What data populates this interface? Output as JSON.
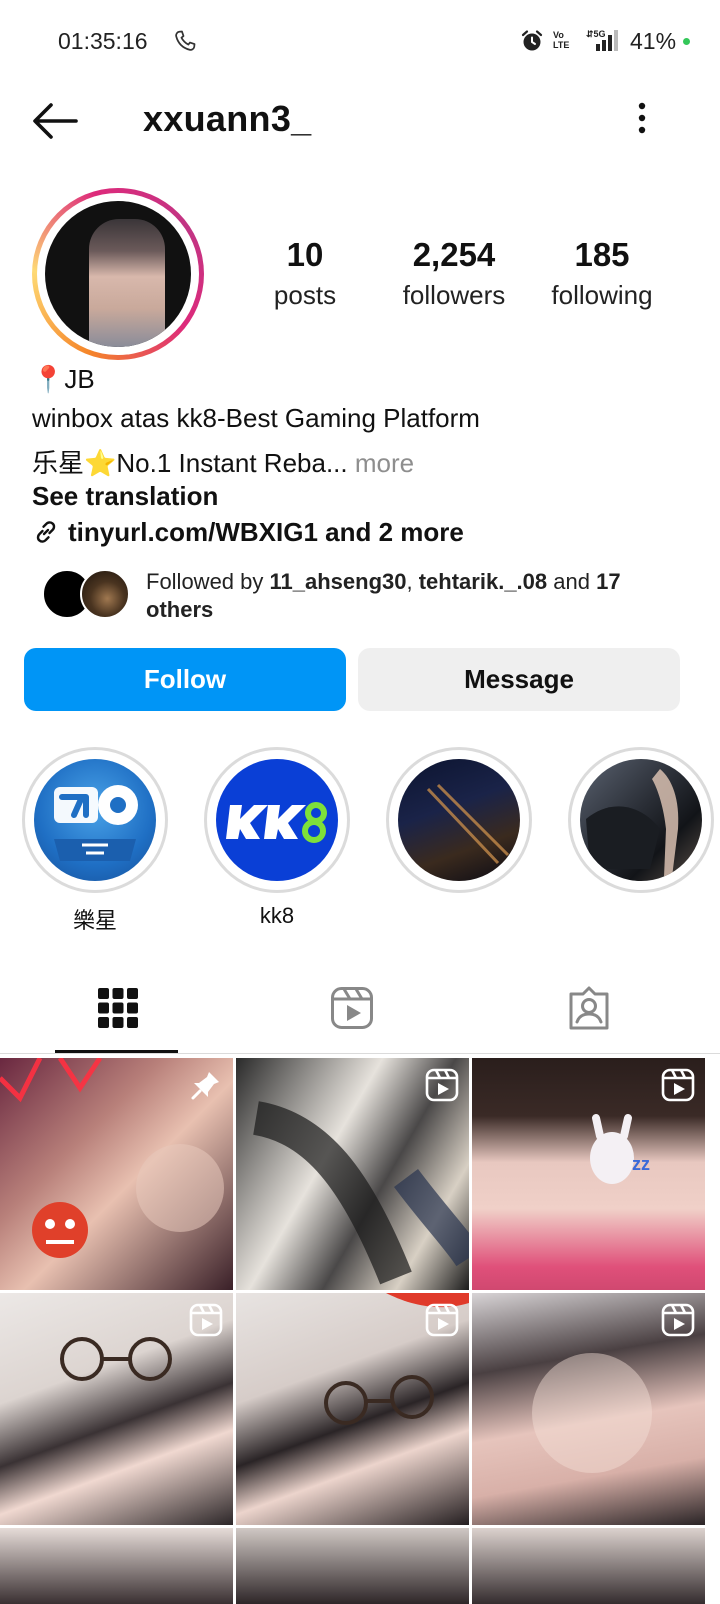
{
  "status_bar": {
    "time": "01:35:16",
    "battery": "41%",
    "network": "5G",
    "volte": "Vo LTE"
  },
  "header": {
    "username": "xxuann3_"
  },
  "profile": {
    "stats": [
      {
        "count": "10",
        "label": "posts"
      },
      {
        "count": "2,254",
        "label": "followers"
      },
      {
        "count": "185",
        "label": "following"
      }
    ],
    "bio": {
      "location": "📍JB",
      "line1": "winbox atas kk8-Best Gaming Platform",
      "line2": "乐星⭐No.1 Instant Reba...",
      "more_label": "more",
      "see_translation": "See translation",
      "link": "tinyurl.com/WBXIG1 and 2 more"
    },
    "followed_by": {
      "prefix": "Followed by ",
      "user1": "11_ahseng30",
      "sep": ", ",
      "user2": "tehtarik._.08",
      "suffix_and": " and ",
      "others_count": "17",
      "others_label": "others"
    }
  },
  "actions": {
    "follow_label": "Follow",
    "message_label": "Message"
  },
  "highlights": [
    {
      "label": "樂星"
    },
    {
      "label": "kk8"
    },
    {
      "label": ""
    },
    {
      "label": ""
    }
  ],
  "tabs": [
    {
      "name": "posts-grid",
      "icon": "grid-icon",
      "active": true
    },
    {
      "name": "reels",
      "icon": "reels-icon",
      "active": false
    },
    {
      "name": "tagged",
      "icon": "tagged-icon",
      "active": false
    }
  ],
  "posts": [
    {
      "type": "pinned",
      "icon": "pin-icon"
    },
    {
      "type": "reel",
      "icon": "reel-icon"
    },
    {
      "type": "reel",
      "icon": "reel-icon"
    },
    {
      "type": "reel",
      "icon": "reel-icon"
    },
    {
      "type": "reel",
      "icon": "reel-icon"
    },
    {
      "type": "reel",
      "icon": "reel-icon"
    }
  ],
  "colors": {
    "follow_button": "#0095f6",
    "message_button": "#efefef",
    "secondary_text": "#8e8e8e"
  }
}
